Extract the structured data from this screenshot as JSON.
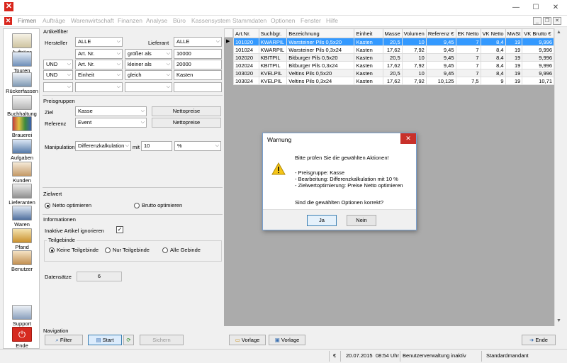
{
  "app": {
    "title": ""
  },
  "menu": {
    "items": [
      "Firmen",
      "Aufträge",
      "Warenwirtschaft",
      "Finanzen",
      "Analyse",
      "Büro",
      "Kassensystem",
      "Stammdaten",
      "Optionen",
      "Fenster",
      "Hilfe"
    ]
  },
  "sidebar": {
    "items": [
      {
        "label": "Aufträge",
        "icon": "orders-icon"
      },
      {
        "label": "Touren",
        "icon": "truck-icon"
      },
      {
        "label": "Rückerfassen",
        "icon": "return-truck-icon"
      },
      {
        "label": "Buchhaltung",
        "icon": "accounting-icon"
      },
      {
        "label": "Brauerei",
        "icon": "brewery-icon"
      },
      {
        "label": "Aufgaben",
        "icon": "tasks-icon"
      },
      {
        "label": "Kunden",
        "icon": "customers-icon"
      },
      {
        "label": "Lieferanten",
        "icon": "suppliers-icon"
      },
      {
        "label": "Waren",
        "icon": "goods-icon"
      },
      {
        "label": "Pfand",
        "icon": "deposit-icon"
      },
      {
        "label": "Benutzer",
        "icon": "user-icon"
      },
      {
        "label": "Support",
        "icon": "support-icon"
      },
      {
        "label": "Ende",
        "icon": "power-icon"
      }
    ]
  },
  "filter": {
    "group_label": "Artikelfilter",
    "hersteller_label": "Hersteller",
    "hersteller_value": "ALLE",
    "lieferant_label": "Lieferant",
    "lieferant_value": "ALLE",
    "rows": [
      {
        "op": "",
        "field": "Art. Nr.",
        "cmp": "größer als",
        "value": "10000"
      },
      {
        "op": "UND",
        "field": "Art. Nr.",
        "cmp": "kleiner als",
        "value": "20000"
      },
      {
        "op": "UND",
        "field": "Einheit",
        "cmp": "gleich",
        "value": "Kasten"
      },
      {
        "op": "",
        "field": "",
        "cmp": "",
        "value": ""
      }
    ]
  },
  "price": {
    "group_label": "Preisgruppen",
    "ziel_label": "Ziel",
    "ziel_value": "Kasse",
    "ziel_btn": "Nettopreise",
    "ref_label": "Referenz",
    "ref_value": "Event",
    "ref_btn": "Nettopreise",
    "manip_label": "Manipulation",
    "manip_value": "Differenzkalkulation",
    "mit_label": "mit",
    "mit_value": "10",
    "unit_value": "%"
  },
  "zielwert": {
    "group_label": "Zielwert",
    "opt1": "Netto optimieren",
    "opt2": "Brutto optimieren"
  },
  "info": {
    "group_label": "Informationen",
    "inactive_label": "Inaktive Artikel ignorieren",
    "teil_label": "Teilgebinde",
    "opt1": "Keine Teilgebinde",
    "opt2": "Nur Teilgebinde",
    "opt3": "Alle Gebinde"
  },
  "records": {
    "label": "Datensätze",
    "value": "6"
  },
  "nav": {
    "group_label": "Navigation",
    "filter": "Filter",
    "start": "Start",
    "sichern": "Sichern",
    "vorlage1": "Vorlage",
    "vorlage2": "Vorlage",
    "ende": "Ende"
  },
  "table": {
    "columns": [
      "Art.Nr.",
      "Suchbgr.",
      "Bezeichnung",
      "Einheit",
      "Masse",
      "Volumen",
      "Referenz €",
      "EK Netto",
      "VK Netto",
      "MwSt",
      "VK Brutto €"
    ],
    "rows": [
      [
        "101020",
        "KWARPIL",
        "Warsteiner Pils 0,5x20",
        "Kasten",
        "20,5",
        "10",
        "9,45",
        "7",
        "8,4",
        "19",
        "9,996"
      ],
      [
        "101024",
        "KWARPIL",
        "Warsteiner Pils 0,3x24",
        "Kasten",
        "17,62",
        "7,92",
        "9,45",
        "7",
        "8,4",
        "19",
        "9,996"
      ],
      [
        "102020",
        "KBITPIL",
        "Bitburger Pils 0,5x20",
        "Kasten",
        "20,5",
        "10",
        "9,45",
        "7",
        "8,4",
        "19",
        "9,996"
      ],
      [
        "102024",
        "KBITPIL",
        "Bitburger Pils 0,3x24",
        "Kasten",
        "17,62",
        "7,92",
        "9,45",
        "7",
        "8,4",
        "19",
        "9,996"
      ],
      [
        "103020",
        "KVELPIL",
        "Veltins Pils 0,5x20",
        "Kasten",
        "20,5",
        "10",
        "9,45",
        "7",
        "8,4",
        "19",
        "9,996"
      ],
      [
        "103024",
        "KVELPIL",
        "Veltins Pils 0,3x24",
        "Kasten",
        "17,62",
        "7,92",
        "10,125",
        "7,5",
        "9",
        "19",
        "10,71"
      ]
    ]
  },
  "status": {
    "euro": "€",
    "date": "20.07.2015",
    "time": "08:54 Uhr",
    "mode": "Benutzerverwaltung inaktiv",
    "client": "Standardmandant"
  },
  "dialog": {
    "title": "Warnung",
    "line1": "Bitte prüfen Sie die gewählten Aktionen!",
    "line2": "- Preisgruppe: Kasse",
    "line3": "- Bearbeitung: Differenzkalkulation mit 10 %",
    "line4": "- Zielwertoptimierung: Preise Netto optimieren",
    "line5": "Sind die gewählten Optionen korrekt?",
    "yes": "Ja",
    "no": "Nein"
  },
  "colors": {
    "selection": "#3399ff",
    "brand": "#d9261c"
  }
}
